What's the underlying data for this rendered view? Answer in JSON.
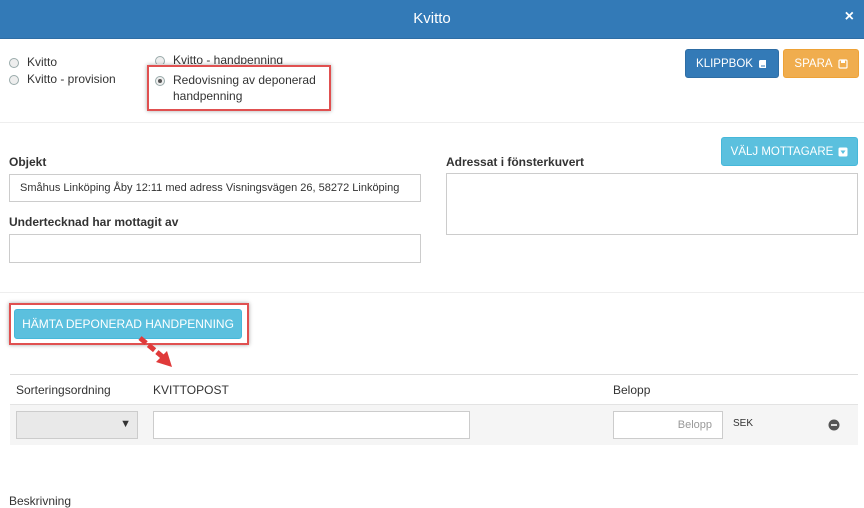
{
  "dialog": {
    "title": "Kvitto",
    "close_glyph": "×"
  },
  "receipt_types": {
    "kvitto": "Kvitto",
    "kvitto_provision": "Kvitto - provision",
    "kvitto_handpenning": "Kvitto - handpenning",
    "redovisning_line1": "Redovisning av deponerad",
    "redovisning_line2": "handpenning",
    "selected": "redovisning"
  },
  "toolbar": {
    "klippbok_label": "KLIPPBOK",
    "klippbok_icon": "book-icon",
    "spara_label": "SPARA",
    "spara_icon": "save-icon"
  },
  "form": {
    "objekt_label": "Objekt",
    "objekt_value": "Småhus Linköping Åby 12:11 med adress Visningsvägen 26,  58272  Linköping",
    "undertecknad_label": "Undertecknad har mottagit av",
    "undertecknad_value": "",
    "adressat_label": "Adressat i fönsterkuvert",
    "valj_mottagare_label": "VÄLJ MOTTAGARE",
    "valj_mottagare_icon": "caret-down-square-icon"
  },
  "hamta_button_label": "HÄMTA DEPONERAD HANDPENNING",
  "grid": {
    "headers": {
      "sort": "Sorteringsordning",
      "post": "KVITTOPOST",
      "amount": "Belopp"
    },
    "row": {
      "belopp_placeholder": "Belopp",
      "currency": "SEK",
      "remove_icon": "minus-circle-icon"
    }
  },
  "beskrivning_label": "Beskrivning",
  "colors": {
    "header": "#337ab7",
    "warning": "#f0ad4e",
    "info": "#5bc0de",
    "highlight": "#e05050"
  }
}
